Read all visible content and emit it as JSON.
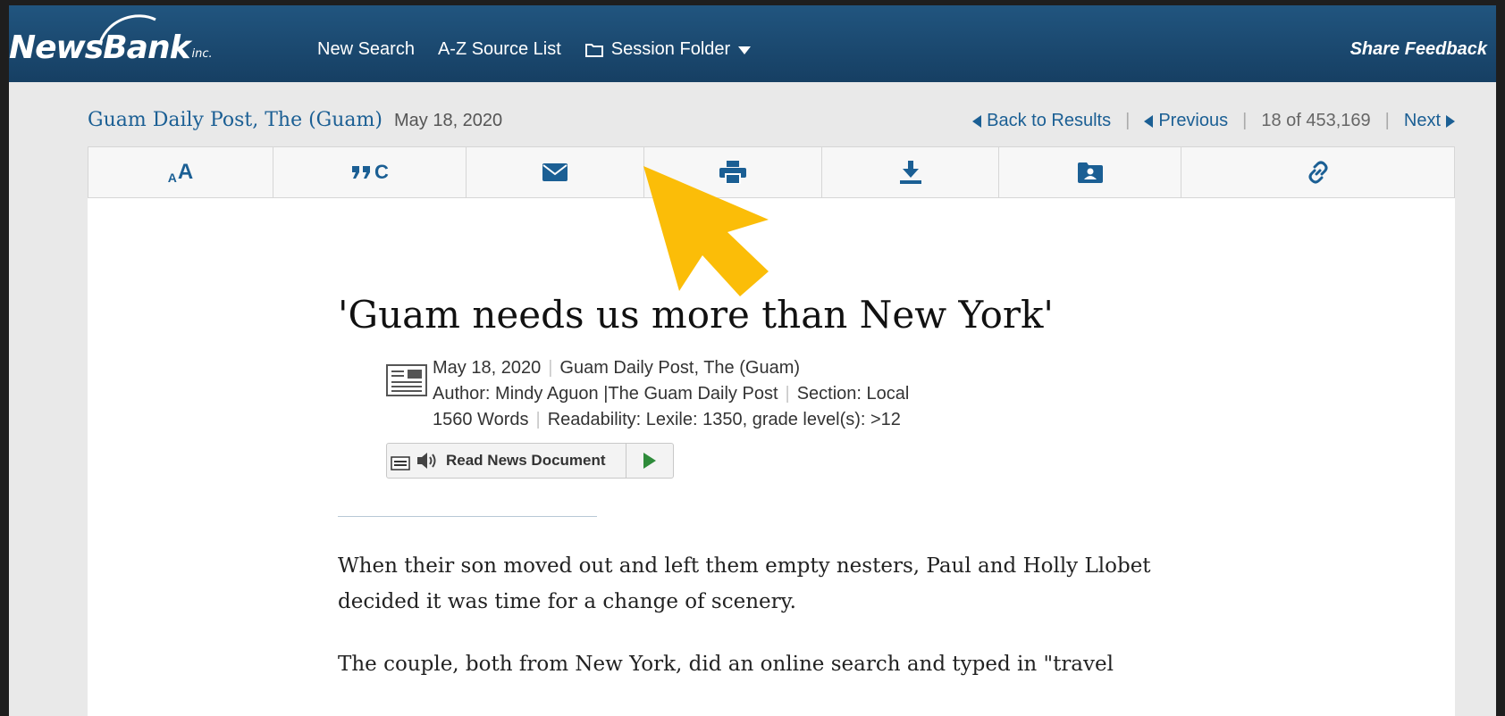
{
  "header": {
    "logo_text": "NewsBank",
    "logo_suffix": "inc.",
    "nav": [
      {
        "label": "New Search"
      },
      {
        "label": "A-Z Source List"
      },
      {
        "label": "Session Folder"
      }
    ],
    "share_feedback": "Share Feedback"
  },
  "document_bar": {
    "source_title": "Guam Daily Post, The (Guam)",
    "source_date": "May 18, 2020",
    "back_to_results": "Back to Results",
    "previous": "Previous",
    "position": "18 of 453,169",
    "next": "Next"
  },
  "toolbar": {
    "font_size_small": "A",
    "font_size_large": "A",
    "cite_label": "C"
  },
  "article": {
    "headline": "'Guam needs us more than New York'",
    "date": "May 18, 2020",
    "source": "Guam Daily Post, The (Guam)",
    "author": "Author: Mindy Aguon |The Guam Daily Post",
    "section": "Section: Local",
    "words": "1560 Words",
    "readability": "Readability: Lexile: 1350, grade level(s): >12",
    "read_button": "Read News Document",
    "paragraphs": [
      "When their son moved out and left them empty nesters, Paul and Holly Llobet decided it was time for a change of scenery.",
      "The couple, both from New York, did an online search and typed in \"travel"
    ]
  },
  "colors": {
    "header_bg": "#1d4d76",
    "link": "#1b5f94",
    "pointer_arrow": "#fbbd08",
    "play": "#2e8b3a"
  }
}
